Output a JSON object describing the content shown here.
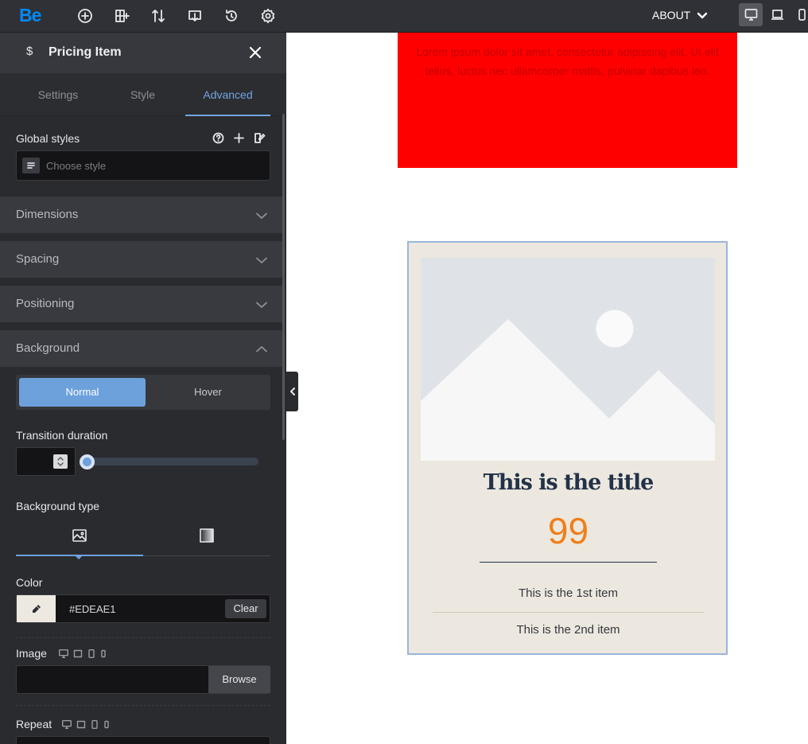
{
  "topbar": {
    "logo": "Be",
    "icons": [
      "add-icon",
      "layout-add-icon",
      "sort-icon",
      "import-icon",
      "history-icon",
      "settings-icon"
    ],
    "menu_label": "ABOUT",
    "devices": [
      "desktop-icon",
      "laptop-icon",
      "mobile-icon"
    ]
  },
  "panel": {
    "icon_symbol": "$",
    "title": "Pricing Item",
    "tabs": [
      {
        "label": "Settings"
      },
      {
        "label": "Style"
      },
      {
        "label": "Advanced"
      }
    ],
    "active_tab": "Advanced"
  },
  "global_styles": {
    "label": "Global styles",
    "placeholder": "Choose style"
  },
  "accordions": [
    {
      "label": "Dimensions",
      "expanded": false
    },
    {
      "label": "Spacing",
      "expanded": false
    },
    {
      "label": "Positioning",
      "expanded": false
    },
    {
      "label": "Background",
      "expanded": true
    }
  ],
  "background": {
    "state_buttons": [
      "Normal",
      "Hover"
    ],
    "active_state": "Normal",
    "transition_label": "Transition duration",
    "transition_value": "",
    "type_label": "Background type",
    "type_options": [
      "image-icon",
      "gradient-icon"
    ],
    "color_label": "Color",
    "color_value": "#EDEAE1",
    "clear_label": "Clear",
    "image_label": "Image",
    "browse_label": "Browse",
    "repeat_label": "Repeat"
  },
  "canvas": {
    "red_text": "Lorem ipsum dolor sit amet, consectetur adipiscing elit. Ut elit tellus, luctus nec ullamcorper mattis, pulvinar dapibus leo.",
    "pricing": {
      "title": "This is the title",
      "price": "99",
      "items": [
        "This is the 1st item",
        "This is the 2nd item"
      ]
    }
  },
  "colors": {
    "accent": "#6da1dc",
    "red_block": "#ff0000",
    "pricing_bg": "#ede9e1",
    "price_orange": "#f07f1b",
    "title_navy": "#223248"
  }
}
